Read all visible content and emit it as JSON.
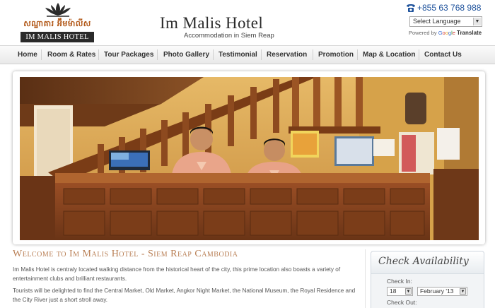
{
  "header": {
    "logo_khmer": "សណ្ឋាគារ អ៊ឹមម៉ាលីស",
    "logo_text": "IM MALIS HOTEL",
    "title": "Im Malis Hotel",
    "tagline": "Accommodation in Siem Reap",
    "phone": "+855 63 768 988",
    "language_select": "Select Language",
    "powered_by": "Powered by",
    "google": [
      "G",
      "o",
      "o",
      "g",
      "l",
      "e"
    ],
    "translate": "Translate"
  },
  "nav": {
    "items": [
      {
        "label": "Home"
      },
      {
        "label": "Room & Rates"
      },
      {
        "label": "Tour Packages"
      },
      {
        "label": "Photo Gallery"
      },
      {
        "label": "Testimonial"
      },
      {
        "label": "Reservation"
      },
      {
        "label": "Promotion"
      },
      {
        "label": "Map & Location"
      },
      {
        "label": "Contact Us"
      }
    ]
  },
  "welcome": {
    "title": "Welcome to Im Malis Hotel - Siem Reap Cambodia",
    "p1": "Im Malis Hotel is centraly located walking distance from the historical heart of the city, this prime location also boasts a variety of entertainment clubs and brilliant restaurants.",
    "p2": "Tourists will be delighted to find the Central Market, Old Market, Angkor Night Market, the National Museum, the Royal Residence and the City River just a short stroll away."
  },
  "availability": {
    "title": "Check Availability",
    "check_in_label": "Check In:",
    "check_in_day": "18",
    "check_in_month": "February '13",
    "check_out_label": "Check Out:"
  },
  "colors": {
    "phone": "#1a4f9a",
    "welcome_title": "#b97f55",
    "wood": "#8a4a22"
  },
  "icons": {
    "phone": "phone-icon",
    "logo": "lotus-logo-icon"
  }
}
